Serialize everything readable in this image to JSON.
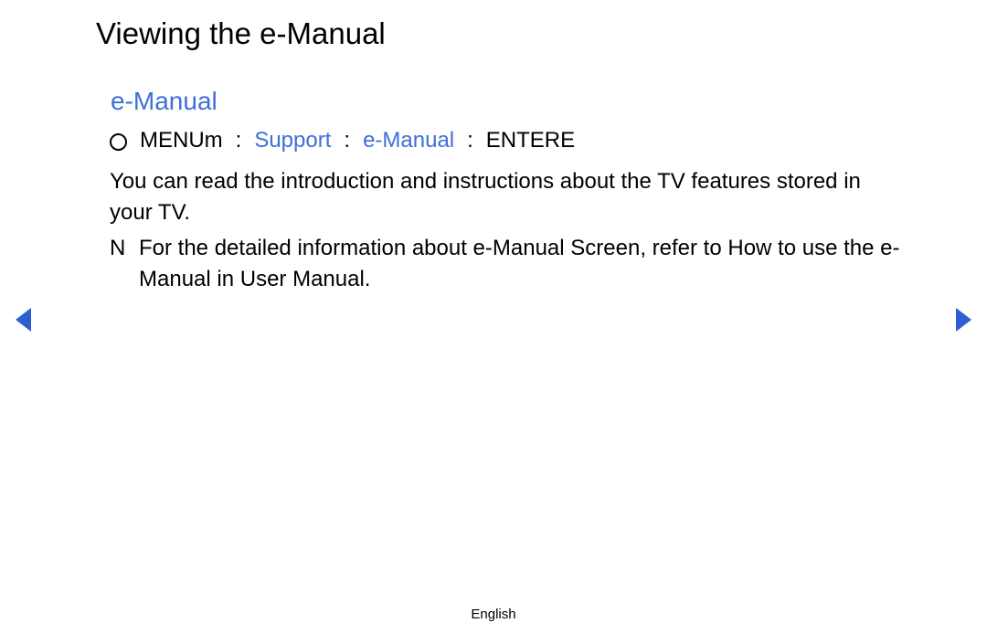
{
  "page_title": "Viewing the e-Manual",
  "section_title": "e-Manual",
  "nav_path": {
    "menu": "MENUm",
    "sep": ":",
    "support": "Support",
    "emanual": "e-Manual",
    "enter": "ENTERE"
  },
  "paragraph1": "You can read the introduction and instructions about the TV features stored in your TV.",
  "note": {
    "icon": "N",
    "text": "For the detailed information about e-Manual Screen, refer to  How to use the e-Manual  in User Manual."
  },
  "footer_language": "English",
  "colors": {
    "link_blue": "#3f6fd8",
    "arrow_blue": "#2e5fd0"
  }
}
